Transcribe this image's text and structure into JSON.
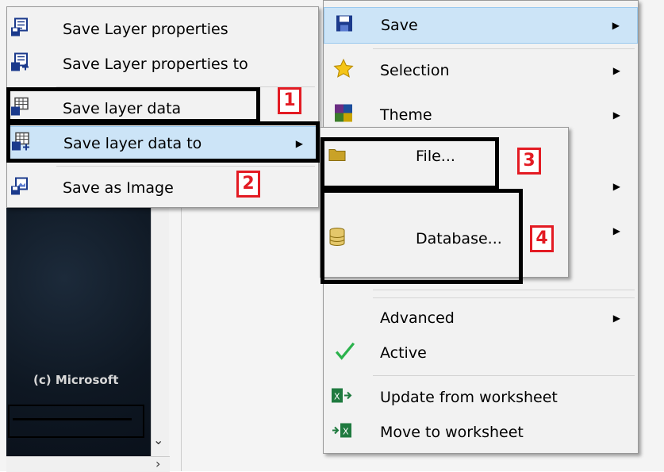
{
  "left_menu": {
    "items": [
      {
        "label": "Save Layer properties"
      },
      {
        "label": "Save Layer properties to"
      },
      {
        "label": "Save layer data"
      },
      {
        "label": "Save layer data to"
      },
      {
        "label": "Save as Image"
      }
    ]
  },
  "main_menu": {
    "items": [
      {
        "label": "Save"
      },
      {
        "label": "Selection"
      },
      {
        "label": "Theme"
      },
      {
        "label": "Advanced"
      },
      {
        "label": "Active"
      },
      {
        "label": "Update from worksheet"
      },
      {
        "label": "Move to worksheet"
      }
    ]
  },
  "sub_menu": {
    "items": [
      {
        "label": "File..."
      },
      {
        "label": "Database..."
      }
    ]
  },
  "callouts": [
    "1",
    "2",
    "3",
    "4"
  ],
  "map": {
    "credit": "(c) Microsoft"
  },
  "colors": {
    "highlight": "#cce4f7",
    "callout_red": "#e31b23",
    "accent_blue": "#1b3a8c",
    "check_green": "#2bb24c"
  }
}
